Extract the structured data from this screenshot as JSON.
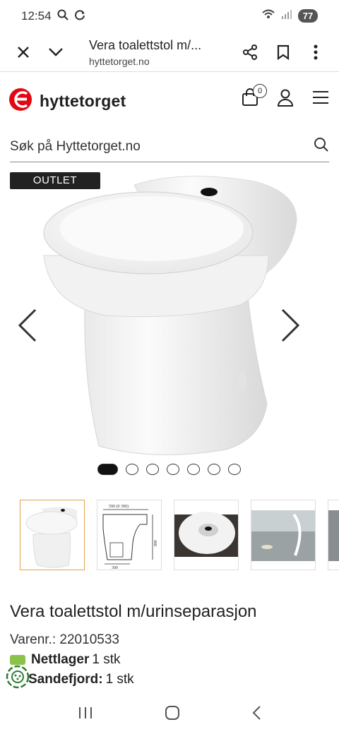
{
  "status": {
    "time": "12:54",
    "battery": "77"
  },
  "browser": {
    "title": "Vera toalettstol m/...",
    "url": "hyttetorget.no"
  },
  "site": {
    "logo_text": "hyttetorget",
    "cart_count": "0",
    "brand_color": "#e30613"
  },
  "search": {
    "placeholder": "Søk på Hyttetorget.no"
  },
  "gallery": {
    "badge": "OUTLET",
    "dot_count": 7,
    "active_index": 0,
    "thumb_dims": {
      "width": "590 (0 390)",
      "height": "400",
      "base": "300"
    }
  },
  "product": {
    "title": "Vera toalettstol m/urinseparasjon",
    "sku_label": "Varenr.:",
    "sku": "22010533",
    "stock": [
      {
        "location": "Nettlager",
        "qty": "1 stk"
      },
      {
        "location": "Sandefjord:",
        "qty": "1 stk"
      }
    ]
  }
}
